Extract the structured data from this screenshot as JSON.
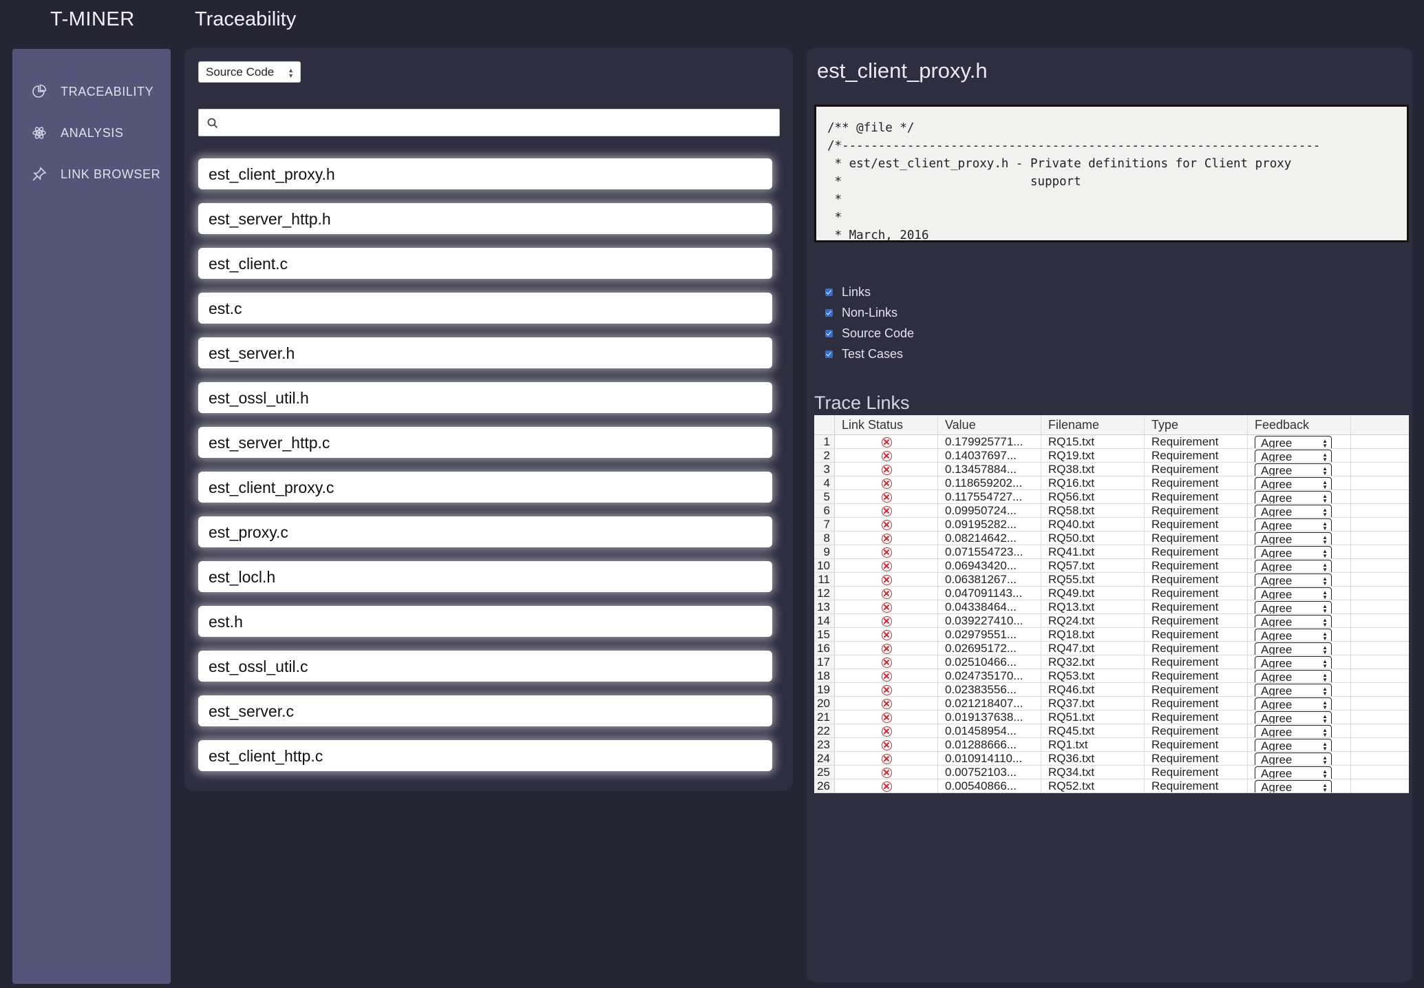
{
  "app": {
    "title": "T-MINER",
    "page_title": "Traceability"
  },
  "sidebar": {
    "items": [
      {
        "label": "TRACEABILITY",
        "icon": "pie-chart-icon"
      },
      {
        "label": "ANALYSIS",
        "icon": "atom-icon"
      },
      {
        "label": "LINK BROWSER",
        "icon": "pin-icon"
      }
    ]
  },
  "files": {
    "filter_select": "Source Code",
    "search_value": "",
    "items": [
      "est_client_proxy.h",
      "est_server_http.h",
      "est_client.c",
      "est.c",
      "est_server.h",
      "est_ossl_util.h",
      "est_server_http.c",
      "est_client_proxy.c",
      "est_proxy.c",
      "est_locl.h",
      "est.h",
      "est_ossl_util.c",
      "est_server.c",
      "est_client_http.c"
    ]
  },
  "detail": {
    "file_name": "est_client_proxy.h",
    "code": "/** @file */\n/*------------------------------------------------------------------\n * est/est_client_proxy.h - Private definitions for Client proxy\n *                          support\n *\n *\n * March, 2016",
    "filters": [
      "Links",
      "Non-Links",
      "Source Code",
      "Test Cases"
    ],
    "trace_title": "Trace Links",
    "columns": [
      "Link Status",
      "Value",
      "Filename",
      "Type",
      "Feedback"
    ],
    "rows": [
      {
        "idx": "1",
        "value": "0.179925771...",
        "file": "RQ15.txt",
        "type": "Requirement",
        "feedback": "Agree"
      },
      {
        "idx": "2",
        "value": "0.14037697...",
        "file": "RQ19.txt",
        "type": "Requirement",
        "feedback": "Agree"
      },
      {
        "idx": "3",
        "value": "0.13457884...",
        "file": "RQ38.txt",
        "type": "Requirement",
        "feedback": "Agree"
      },
      {
        "idx": "4",
        "value": "0.118659202...",
        "file": "RQ16.txt",
        "type": "Requirement",
        "feedback": "Agree"
      },
      {
        "idx": "5",
        "value": "0.117554727...",
        "file": "RQ56.txt",
        "type": "Requirement",
        "feedback": "Agree"
      },
      {
        "idx": "6",
        "value": "0.09950724...",
        "file": "RQ58.txt",
        "type": "Requirement",
        "feedback": "Agree"
      },
      {
        "idx": "7",
        "value": "0.09195282...",
        "file": "RQ40.txt",
        "type": "Requirement",
        "feedback": "Agree"
      },
      {
        "idx": "8",
        "value": "0.08214642...",
        "file": "RQ50.txt",
        "type": "Requirement",
        "feedback": "Agree"
      },
      {
        "idx": "9",
        "value": "0.071554723...",
        "file": "RQ41.txt",
        "type": "Requirement",
        "feedback": "Agree"
      },
      {
        "idx": "10",
        "value": "0.06943420...",
        "file": "RQ57.txt",
        "type": "Requirement",
        "feedback": "Agree"
      },
      {
        "idx": "11",
        "value": "0.06381267...",
        "file": "RQ55.txt",
        "type": "Requirement",
        "feedback": "Agree"
      },
      {
        "idx": "12",
        "value": "0.047091143...",
        "file": "RQ49.txt",
        "type": "Requirement",
        "feedback": "Agree"
      },
      {
        "idx": "13",
        "value": "0.04338464...",
        "file": "RQ13.txt",
        "type": "Requirement",
        "feedback": "Agree"
      },
      {
        "idx": "14",
        "value": "0.039227410...",
        "file": "RQ24.txt",
        "type": "Requirement",
        "feedback": "Agree"
      },
      {
        "idx": "15",
        "value": "0.02979551...",
        "file": "RQ18.txt",
        "type": "Requirement",
        "feedback": "Agree"
      },
      {
        "idx": "16",
        "value": "0.02695172...",
        "file": "RQ47.txt",
        "type": "Requirement",
        "feedback": "Agree"
      },
      {
        "idx": "17",
        "value": "0.02510466...",
        "file": "RQ32.txt",
        "type": "Requirement",
        "feedback": "Agree"
      },
      {
        "idx": "18",
        "value": "0.024735170...",
        "file": "RQ53.txt",
        "type": "Requirement",
        "feedback": "Agree"
      },
      {
        "idx": "19",
        "value": "0.02383556...",
        "file": "RQ46.txt",
        "type": "Requirement",
        "feedback": "Agree"
      },
      {
        "idx": "20",
        "value": "0.021218407...",
        "file": "RQ37.txt",
        "type": "Requirement",
        "feedback": "Agree"
      },
      {
        "idx": "21",
        "value": "0.019137638...",
        "file": "RQ51.txt",
        "type": "Requirement",
        "feedback": "Agree"
      },
      {
        "idx": "22",
        "value": "0.01458954...",
        "file": "RQ45.txt",
        "type": "Requirement",
        "feedback": "Agree"
      },
      {
        "idx": "23",
        "value": "0.01288666...",
        "file": "RQ1.txt",
        "type": "Requirement",
        "feedback": "Agree"
      },
      {
        "idx": "24",
        "value": "0.010914110...",
        "file": "RQ36.txt",
        "type": "Requirement",
        "feedback": "Agree"
      },
      {
        "idx": "25",
        "value": "0.00752103...",
        "file": "RQ34.txt",
        "type": "Requirement",
        "feedback": "Agree"
      },
      {
        "idx": "26",
        "value": "0.00540866...",
        "file": "RQ52.txt",
        "type": "Requirement",
        "feedback": "Agree"
      }
    ]
  },
  "colors": {
    "background": "#252634",
    "panel": "#2d2e40",
    "sidebar": "#535679",
    "status_error": "#d8232a",
    "checkbox": "#2f6ee0"
  }
}
